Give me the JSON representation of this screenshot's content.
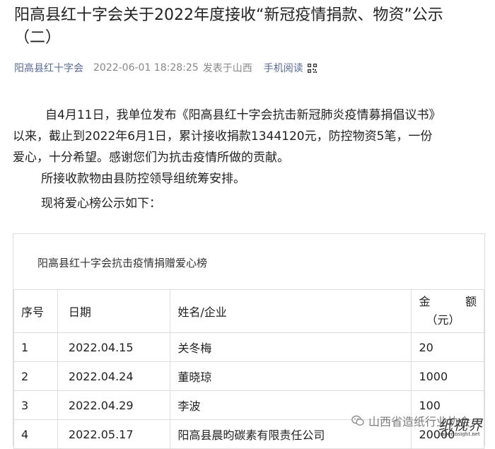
{
  "article": {
    "title": "阳高县红十字会关于2022年度接收“新冠疫情捐款、物资”公示（二）",
    "org": "阳高县红十字会",
    "datetime": "2022-06-01 18:28:25",
    "published_from": "发表于山西",
    "mobile_read": "手机阅读",
    "paragraphs": [
      "自4月11日，我单位发布《阳高县红十字会抗击新冠肺炎疫情募捐倡议书》以来，截止到2022年6月1日，累计接收捐款1344120元，防控物资5笔，一份爱心，十分希望。感谢您们为抗击疫情所做的贡献。",
      "所接收款物由县防控领导组统筹安排。",
      "现将爱心榜公示如下："
    ]
  },
  "table": {
    "caption": "阳高县红十字会抗击疫情捐赠爱心榜",
    "headers": {
      "no": "序号",
      "date": "日期",
      "name": "姓名/企业",
      "amount_a": "金",
      "amount_b": "额",
      "amount_unit": "（元）"
    },
    "rows": [
      {
        "no": "1",
        "date": "2022.04.15",
        "name": "关冬梅",
        "amount": "20"
      },
      {
        "no": "2",
        "date": "2022.04.24",
        "name": "董晓琼",
        "amount": "1000"
      },
      {
        "no": "3",
        "date": "2022.04.29",
        "name": "李波",
        "amount": "100"
      },
      {
        "no": "4",
        "date": "2022.05.17",
        "name": "阳高县晨昀碳素有限责任公司",
        "amount": "20000"
      }
    ]
  },
  "watermark": {
    "text": "山西省造纸行业协会",
    "logo": "纸视界",
    "logo_domain": "paperinsight.net",
    "icon": "wechat-icon"
  }
}
